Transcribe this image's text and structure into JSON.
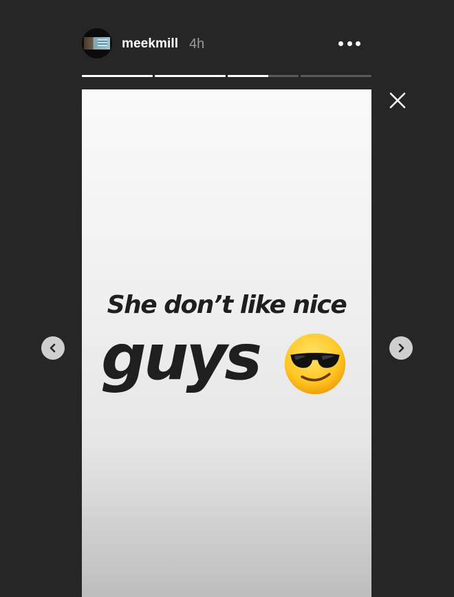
{
  "header": {
    "username": "meekmill",
    "time": "4h"
  },
  "progress": [
    1,
    1,
    0.57,
    0
  ],
  "story": {
    "line1": "She don’t like nice",
    "line2": "guys",
    "emoji": "smiling-face-with-sunglasses-icon"
  },
  "colors": {
    "background": "#262626",
    "text": "#1f1f1f",
    "accent": "#ffffff"
  }
}
